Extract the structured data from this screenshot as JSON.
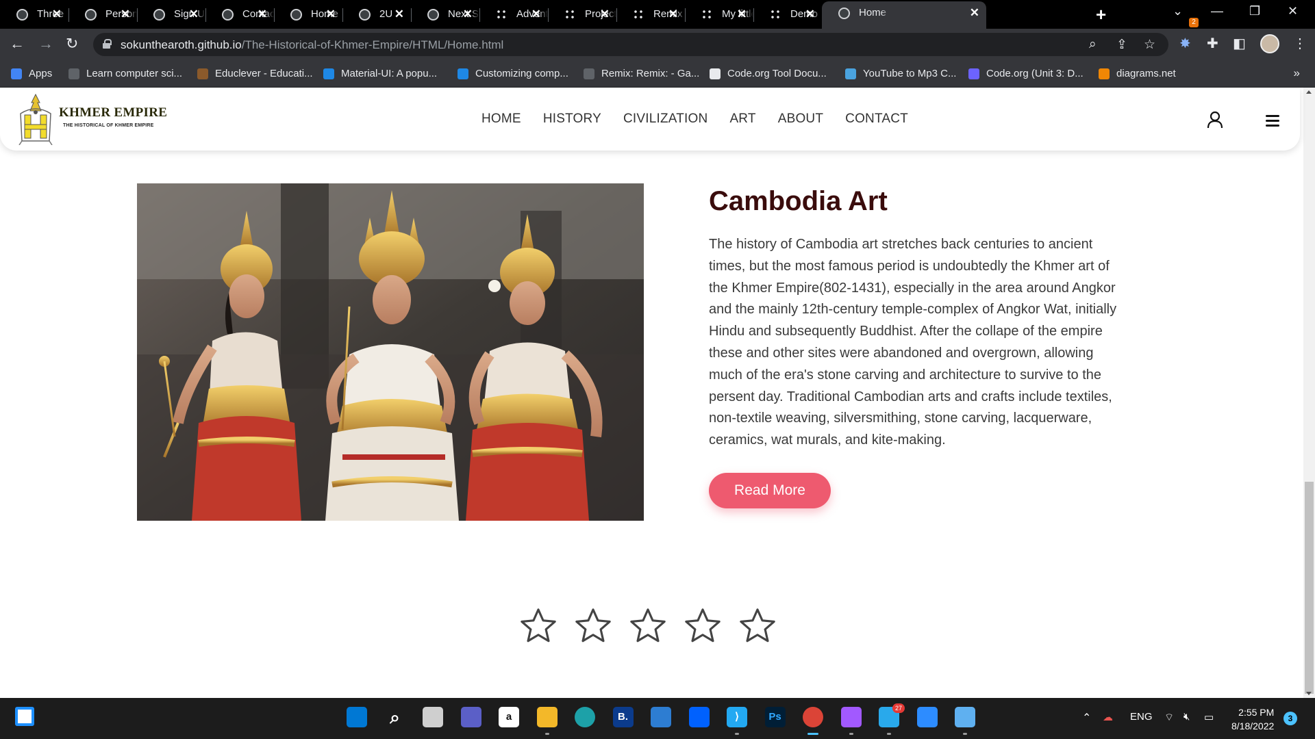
{
  "browser": {
    "tabs": [
      {
        "title": "Three",
        "icon": "globe-icon"
      },
      {
        "title": "Personal",
        "icon": "globe-icon"
      },
      {
        "title": "Sign Up",
        "icon": "globe-icon"
      },
      {
        "title": "Contact",
        "icon": "globe-icon"
      },
      {
        "title": "Home",
        "icon": "globe-icon"
      },
      {
        "title": "2U",
        "icon": "site-icon"
      },
      {
        "title": "Next S",
        "icon": "site-icon"
      },
      {
        "title": "Adventure",
        "icon": "grid-icon"
      },
      {
        "title": "Project",
        "icon": "grid-icon"
      },
      {
        "title": "Remix",
        "icon": "grid-icon"
      },
      {
        "title": "My little",
        "icon": "grid-icon"
      },
      {
        "title": "Demo",
        "icon": "grid-icon"
      },
      {
        "title": "Home",
        "icon": "globe-icon",
        "active": true
      }
    ],
    "url_host": "sokunthearoth.github.io",
    "url_path": "/The-Historical-of-Khmer-Empire/HTML/Home.html",
    "extension_badge": "2",
    "bookmarks": [
      {
        "label": "Apps",
        "color": "#4285f4"
      },
      {
        "label": "Learn computer sci...",
        "color": "#5f6368"
      },
      {
        "label": "Educlever - Educati...",
        "color": "#8b5a2b"
      },
      {
        "label": "Material-UI: A popu...",
        "color": "#1e88e5"
      },
      {
        "label": "Customizing comp...",
        "color": "#1e88e5"
      },
      {
        "label": "Remix: Remix: - Ga...",
        "color": "#5f6368"
      },
      {
        "label": "Code.org Tool Docu...",
        "color": "#e8eaed"
      },
      {
        "label": "YouTube to Mp3 C...",
        "color": "#4aa3df"
      },
      {
        "label": "Code.org (Unit 3: D...",
        "color": "#6c63ff"
      },
      {
        "label": "diagrams.net",
        "color": "#f08705"
      }
    ],
    "bookmarks_more": "»"
  },
  "site": {
    "logo_title": "KHMER EMPIRE",
    "logo_subtitle": "THE HISTORICAL OF KHMER EMPIRE",
    "nav": [
      "HOME",
      "HISTORY",
      "CIVILIZATION",
      "ART",
      "ABOUT",
      "CONTACT"
    ],
    "section_title": "Cambodia Art",
    "section_text": "The history of Cambodia art stretches back centuries to ancient times, but the most famous period is undoubtedly the Khmer art of the Khmer Empire(802-1431), especially in the area around Angkor and the mainly 12th-century temple-complex of Angkor Wat, initially Hindu and subsequently Buddhist. After the collape of the empire these and other sites were abandoned and overgrown, allowing much of the era's stone carving and architecture to survive to the persent day. Traditional Cambodian arts and crafts include textiles, non-textile weaving, silversmithing, stone carving, lacquerware, ceramics, wat murals, and kite-making.",
    "read_more_label": "Read More",
    "rating": {
      "filled": 0,
      "max": 5
    },
    "accent_color": "#ee5a6f"
  },
  "taskbar": {
    "apps": [
      "windows-start-icon",
      "search-icon",
      "task-view-icon",
      "chat-icon",
      "amazon-icon",
      "file-explorer-icon",
      "edge-icon",
      "booking-icon",
      "store-icon",
      "dropbox-icon",
      "vscode-icon",
      "photoshop-icon",
      "chrome-icon",
      "figma-icon",
      "telegram-icon",
      "zoom-icon",
      "notepad-icon"
    ],
    "telegram_badge": "27",
    "language": "ENG",
    "time": "2:55 PM",
    "date": "8/18/2022",
    "notification_count": "3"
  }
}
